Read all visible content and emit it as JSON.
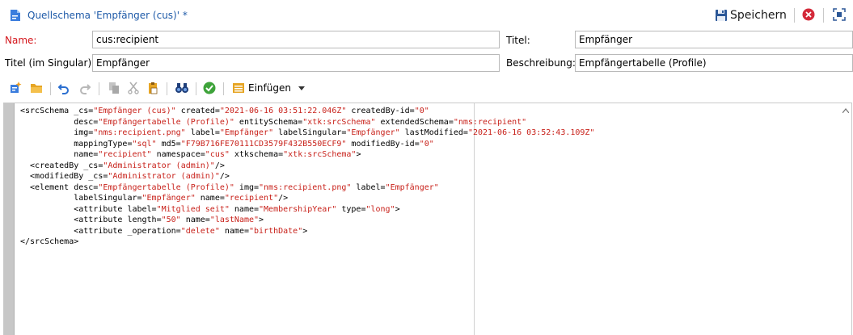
{
  "window": {
    "title": "Quellschema 'Empfänger (cus)' *",
    "save_label": "Speichern"
  },
  "form": {
    "name_label": "Name:",
    "name_value": "cus:recipient",
    "titel_label": "Titel:",
    "titel_value": "Empfänger",
    "singular_label": "Titel (im Singular):",
    "singular_value": "Empfänger",
    "beschreibung_label": "Beschreibung:",
    "beschreibung_value": "Empfängertabelle (Profile)"
  },
  "toolbar": {
    "insert_label": "Einfügen",
    "icons": [
      "new-element-icon",
      "open-folder-icon",
      "undo-icon",
      "redo-icon",
      "copy-icon",
      "cut-icon",
      "paste-icon",
      "find-icon",
      "check-icon",
      "insert-icon"
    ]
  },
  "colors": {
    "title": "#1e5aa8",
    "required_label": "#d4151b",
    "string": "#c8211a",
    "close": "#d42a3a",
    "save_icon": "#2b5797"
  },
  "editor": {
    "lines": [
      [
        {
          "t": "<srcSchema _cs="
        },
        {
          "s": "\"Empfänger (cus)\""
        },
        {
          "t": " created="
        },
        {
          "s": "\"2021-06-16 03:51:22.046Z\""
        },
        {
          "t": " createdBy-id="
        },
        {
          "s": "\"0\""
        }
      ],
      [
        {
          "t": "           desc="
        },
        {
          "s": "\"Empfängertabelle (Profile)\""
        },
        {
          "t": " entitySchema="
        },
        {
          "s": "\"xtk:srcSchema\""
        },
        {
          "t": " extendedSchema="
        },
        {
          "s": "\"nms:recipient\""
        }
      ],
      [
        {
          "t": "           img="
        },
        {
          "s": "\"nms:recipient.png\""
        },
        {
          "t": " label="
        },
        {
          "s": "\"Empfänger\""
        },
        {
          "t": " labelSingular="
        },
        {
          "s": "\"Empfänger\""
        },
        {
          "t": " lastModified="
        },
        {
          "s": "\"2021-06-16 03:52:43.109Z\""
        }
      ],
      [
        {
          "t": "           mappingType="
        },
        {
          "s": "\"sql\""
        },
        {
          "t": " md5="
        },
        {
          "s": "\"F79B716FE70111CD3579F432B550ECF9\""
        },
        {
          "t": " modifiedBy-id="
        },
        {
          "s": "\"0\""
        }
      ],
      [
        {
          "t": "           name="
        },
        {
          "s": "\"recipient\""
        },
        {
          "t": " namespace="
        },
        {
          "s": "\"cus\""
        },
        {
          "t": " xtkschema="
        },
        {
          "s": "\"xtk:srcSchema\""
        },
        {
          "t": ">"
        }
      ],
      [
        {
          "t": "  <createdBy _cs="
        },
        {
          "s": "\"Administrator (admin)\""
        },
        {
          "t": "/>"
        }
      ],
      [
        {
          "t": "  <modifiedBy _cs="
        },
        {
          "s": "\"Administrator (admin)\""
        },
        {
          "t": "/>"
        }
      ],
      [
        {
          "t": "  <element desc="
        },
        {
          "s": "\"Empfängertabelle (Profile)\""
        },
        {
          "t": " img="
        },
        {
          "s": "\"nms:recipient.png\""
        },
        {
          "t": " label="
        },
        {
          "s": "\"Empfänger\""
        }
      ],
      [
        {
          "t": "           labelSingular="
        },
        {
          "s": "\"Empfänger\""
        },
        {
          "t": " name="
        },
        {
          "s": "\"recipient\""
        },
        {
          "t": "/>"
        }
      ],
      [
        {
          "t": "           <attribute label="
        },
        {
          "s": "\"Mitglied seit\""
        },
        {
          "t": " name="
        },
        {
          "s": "\"MembershipYear\""
        },
        {
          "t": " type="
        },
        {
          "s": "\"long\""
        },
        {
          "t": ">"
        }
      ],
      [
        {
          "t": "           <attribute length="
        },
        {
          "s": "\"50\""
        },
        {
          "t": " name="
        },
        {
          "s": "\"lastName\""
        },
        {
          "t": ">"
        }
      ],
      [
        {
          "t": "           <attribute _operation="
        },
        {
          "s": "\"delete\""
        },
        {
          "t": " name="
        },
        {
          "s": "\"birthDate\""
        },
        {
          "t": ">"
        }
      ],
      [
        {
          "t": "</srcSchema>"
        }
      ]
    ]
  }
}
